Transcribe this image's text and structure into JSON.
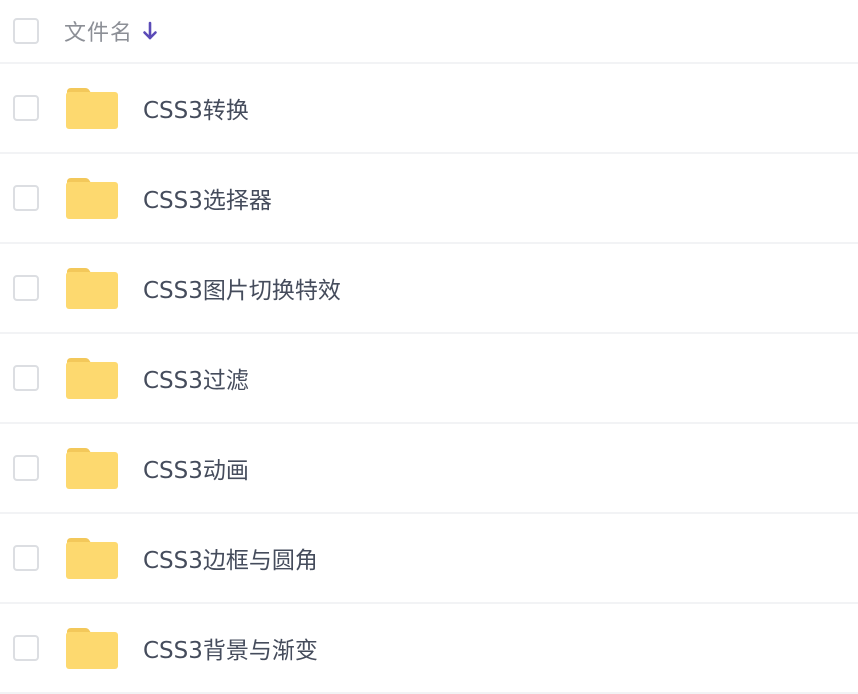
{
  "header": {
    "column_label": "文件名",
    "sort_icon": "arrow-down-icon",
    "accent_color": "#5b4bb7"
  },
  "files": [
    {
      "name": "CSS3转换",
      "icon": "folder-icon"
    },
    {
      "name": "CSS3选择器",
      "icon": "folder-icon"
    },
    {
      "name": "CSS3图片切换特效",
      "icon": "folder-icon"
    },
    {
      "name": "CSS3过滤",
      "icon": "folder-icon"
    },
    {
      "name": "CSS3动画",
      "icon": "folder-icon"
    },
    {
      "name": "CSS3边框与圆角",
      "icon": "folder-icon"
    },
    {
      "name": "CSS3背景与渐变",
      "icon": "folder-icon"
    }
  ],
  "colors": {
    "folder": "#fdd96f",
    "folder_tab": "#f3c85a",
    "text": "#454c5c",
    "header_text": "#8c8f96",
    "divider": "#f2f3f5"
  }
}
